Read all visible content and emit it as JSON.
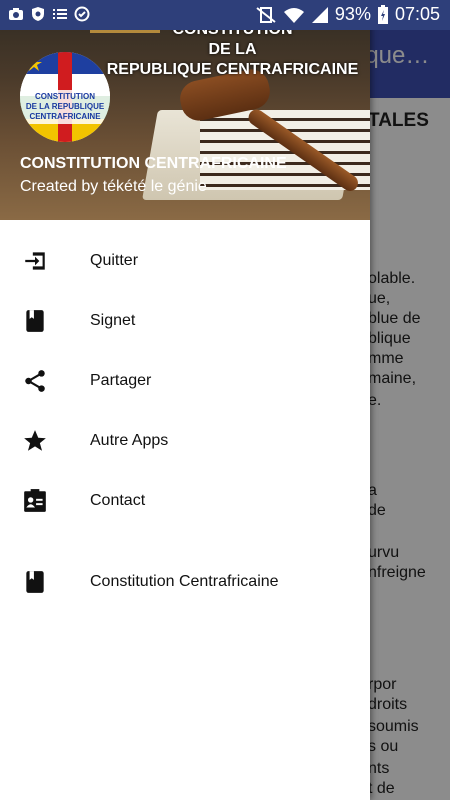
{
  "status_bar": {
    "battery": "93%",
    "time": "07:05"
  },
  "app": {
    "toolbar_title": "ique…",
    "heading": "TALES",
    "lines": [
      "olable.",
      "ue,",
      "blue de",
      "blique",
      "mme",
      "maine,",
      "e.",
      "a",
      "de",
      "urvu",
      "nfreigne",
      "rpor",
      "droits",
      "soumis",
      "s ou",
      "nts",
      "t de"
    ]
  },
  "drawer": {
    "header": {
      "title_line1": "CONSTITUTION",
      "title_line2": "DE LA",
      "title_line3": "REPUBLIQUE CENTRAFRICAINE",
      "logo_text_1": "CONSTITUTION",
      "logo_text_2": "DE LA REPUBLIQUE",
      "logo_text_3": "CENTRAFRICAINE",
      "app_name": "CONSTITUTION CENTRAFRICAINE",
      "author": "Created by tékété le génie"
    },
    "items": [
      {
        "label": "Quitter",
        "icon": "exit-icon"
      },
      {
        "label": "Signet",
        "icon": "bookmark-book-icon"
      },
      {
        "label": "Partager",
        "icon": "share-icon"
      },
      {
        "label": "Autre Apps",
        "icon": "star-icon"
      },
      {
        "label": "Contact",
        "icon": "contact-card-icon"
      },
      {
        "label": "Constitution Centrafricaine",
        "icon": "book-icon"
      }
    ]
  }
}
